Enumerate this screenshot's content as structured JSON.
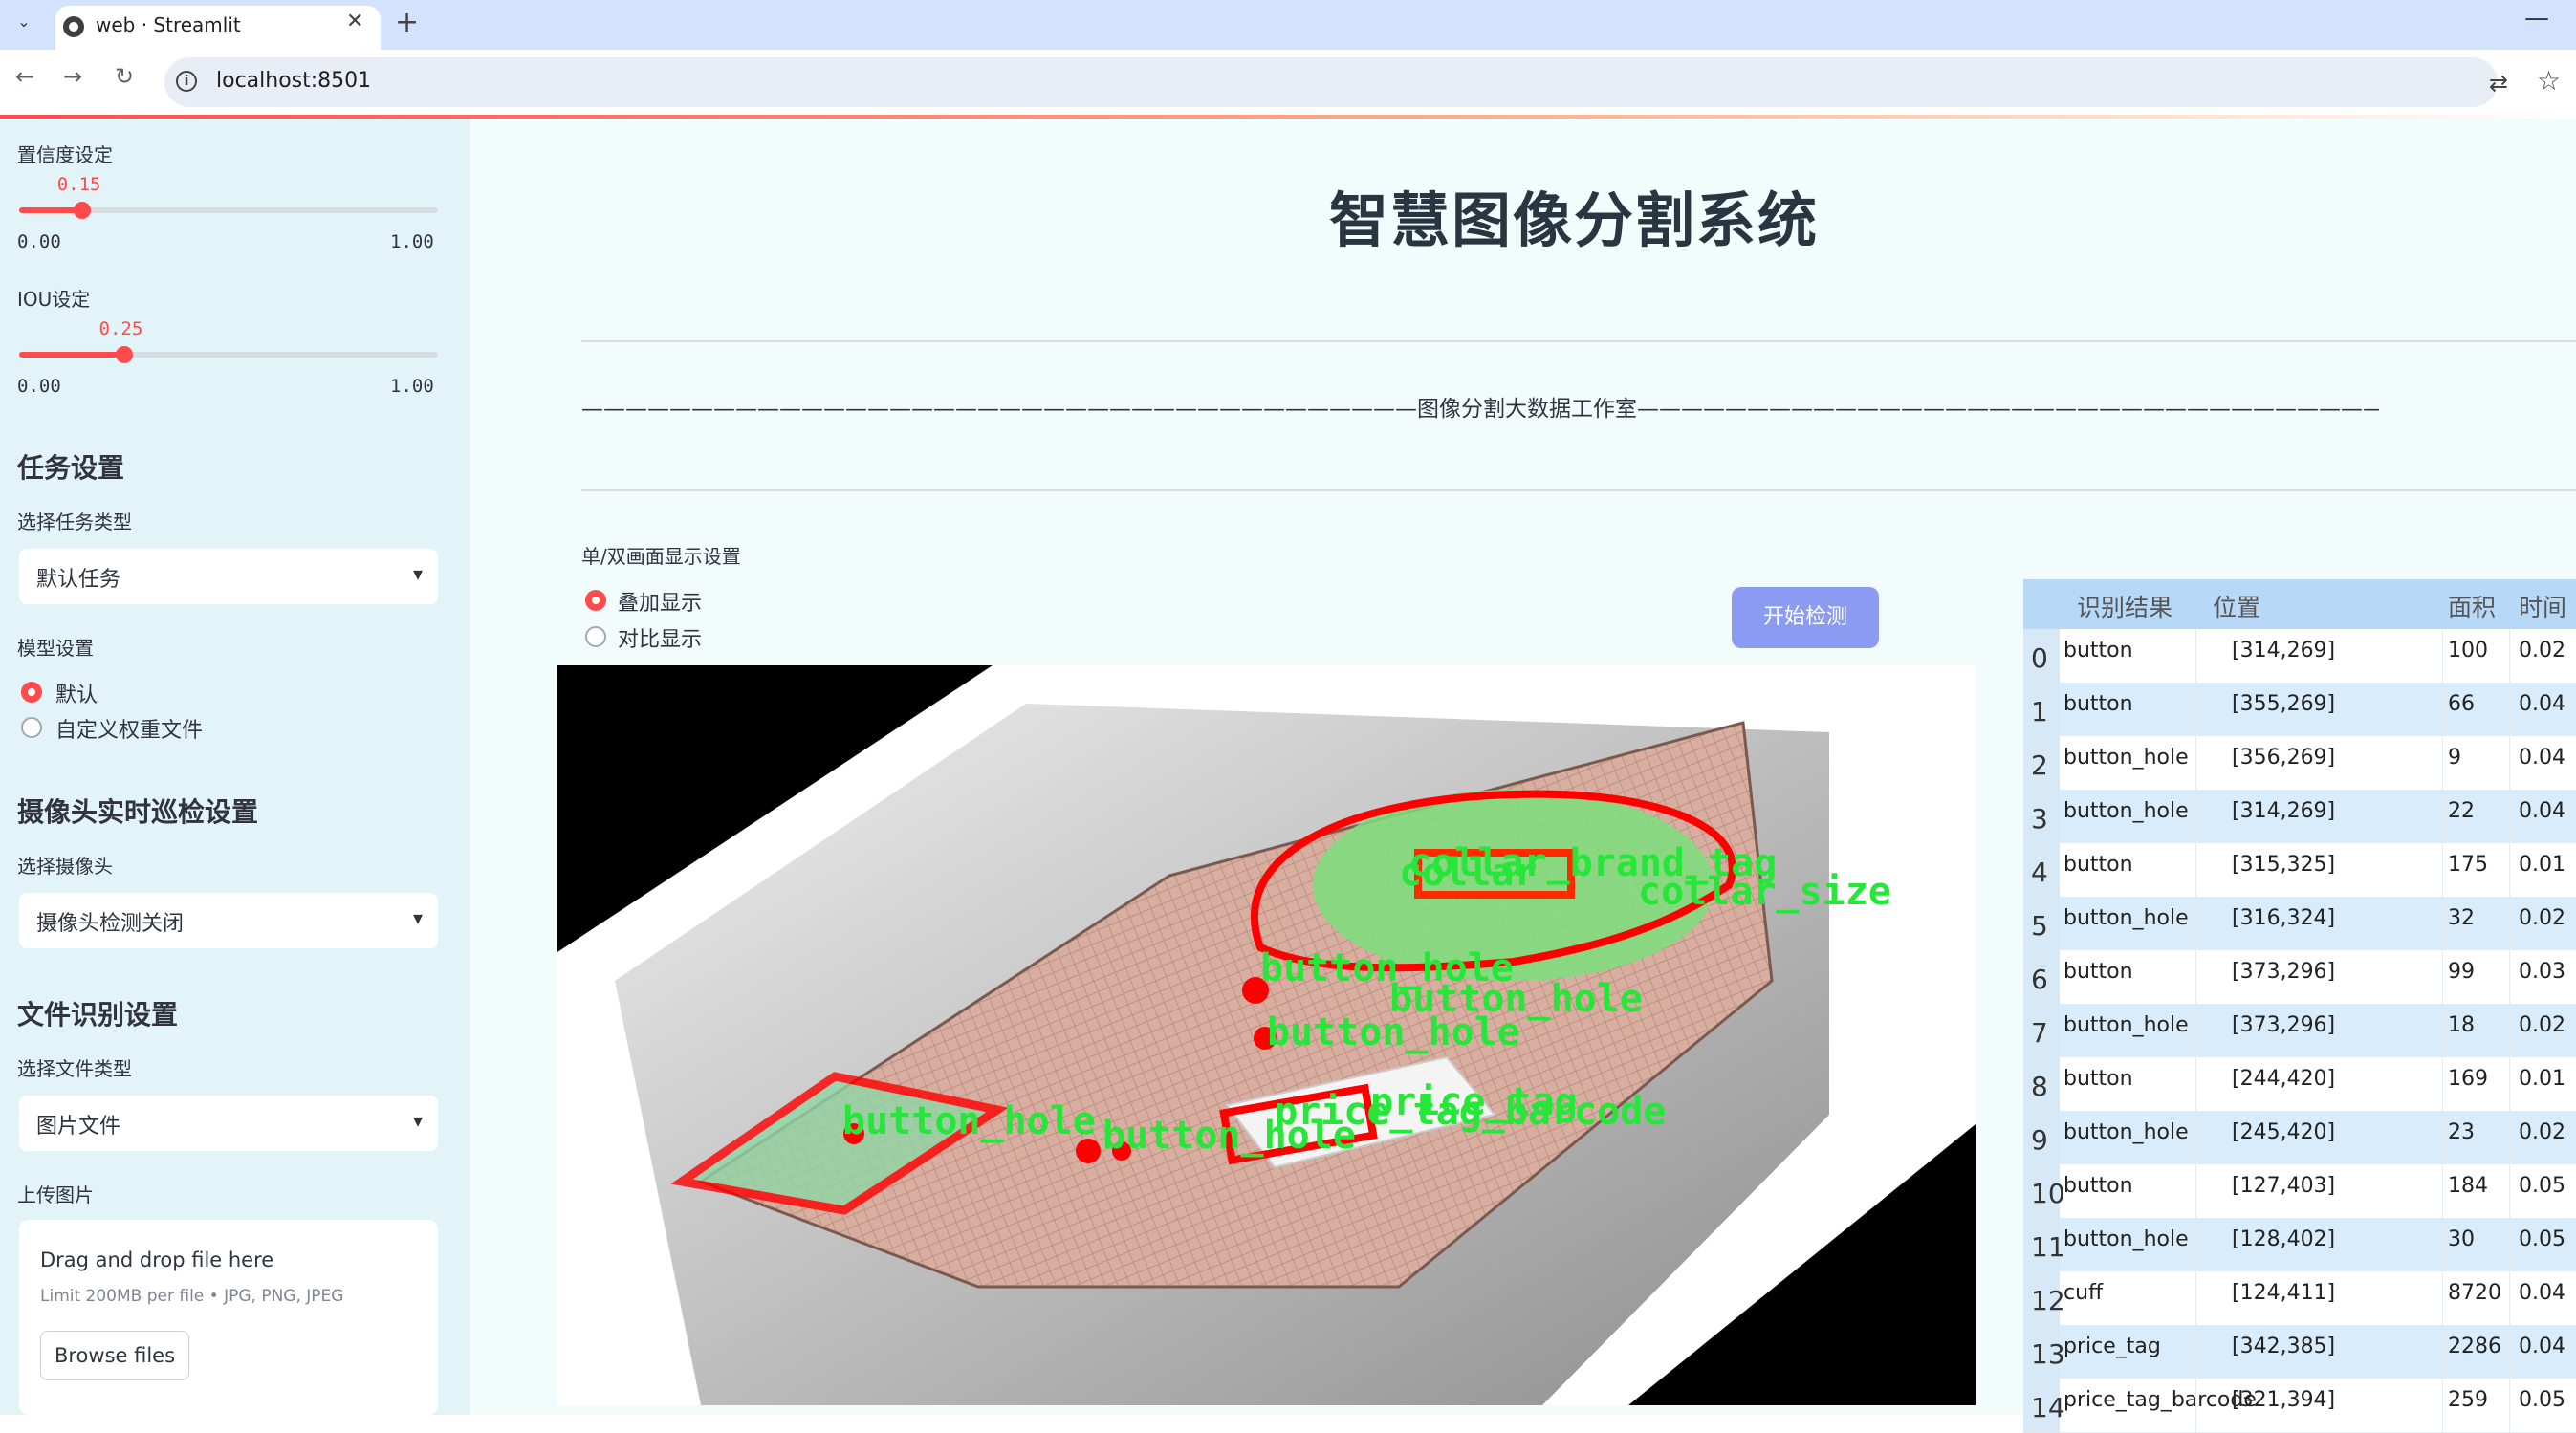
{
  "browser": {
    "tab_title": "web · Streamlit",
    "close_glyph": "✕",
    "newtab_glyph": "+",
    "menu_glyph": "⌄",
    "minimize_glyph": "—",
    "url": "localhost:8501",
    "icons": [
      "back-arrow-icon",
      "forward-arrow-icon",
      "reload-icon",
      "site-info-icon",
      "translate-icon",
      "star-icon"
    ]
  },
  "sidebar": {
    "confidence": {
      "label": "置信度设定",
      "value": "0.15",
      "fraction": 0.15,
      "min": "0.00",
      "max": "1.00"
    },
    "iou": {
      "label": "IOU设定",
      "value": "0.25",
      "fraction": 0.25,
      "min": "0.00",
      "max": "1.00"
    },
    "task_section": "任务设置",
    "task_type_label": "选择任务类型",
    "task_type_value": "默认任务",
    "model_label": "模型设置",
    "model_options": [
      "默认",
      "自定义权重文件"
    ],
    "model_selected": 0,
    "camera_section": "摄像头实时巡检设置",
    "camera_label": "选择摄像头",
    "camera_value": "摄像头检测关闭",
    "file_section": "文件识别设置",
    "file_type_label": "选择文件类型",
    "file_type_value": "图片文件",
    "upload_label": "上传图片",
    "drop_text": "Drag and drop file here",
    "drop_limit": "Limit 200MB per file • JPG, PNG, JPEG",
    "browse_label": "Browse files"
  },
  "main": {
    "title": "智慧图像分割系统",
    "banner": "——————————————————————————————————————图像分割大数据工作室————————————————————————————————————————",
    "display_label": "单/双画面显示设置",
    "display_options": [
      "叠加显示",
      "对比显示"
    ],
    "display_selected": 0,
    "detect_button": "开始检测",
    "overlay_labels": [
      "collar",
      "collar_brand_tag",
      "collar_size",
      "button_hole",
      "button_hole",
      "button_hole",
      "price_tag",
      "price_tag_barcode",
      "button_hole",
      "button_hole"
    ]
  },
  "table": {
    "headers": [
      "识别结果",
      "位置",
      "面积",
      "时间"
    ],
    "rows": [
      {
        "idx": "0",
        "name": "button",
        "pos": "[314,269]",
        "area": "100",
        "time": "0.02"
      },
      {
        "idx": "1",
        "name": "button",
        "pos": "[355,269]",
        "area": "66",
        "time": "0.04"
      },
      {
        "idx": "2",
        "name": "button_hole",
        "pos": "[356,269]",
        "area": "9",
        "time": "0.04"
      },
      {
        "idx": "3",
        "name": "button_hole",
        "pos": "[314,269]",
        "area": "22",
        "time": "0.04"
      },
      {
        "idx": "4",
        "name": "button",
        "pos": "[315,325]",
        "area": "175",
        "time": "0.01"
      },
      {
        "idx": "5",
        "name": "button_hole",
        "pos": "[316,324]",
        "area": "32",
        "time": "0.02"
      },
      {
        "idx": "6",
        "name": "button",
        "pos": "[373,296]",
        "area": "99",
        "time": "0.03"
      },
      {
        "idx": "7",
        "name": "button_hole",
        "pos": "[373,296]",
        "area": "18",
        "time": "0.02"
      },
      {
        "idx": "8",
        "name": "button",
        "pos": "[244,420]",
        "area": "169",
        "time": "0.01"
      },
      {
        "idx": "9",
        "name": "button_hole",
        "pos": "[245,420]",
        "area": "23",
        "time": "0.02"
      },
      {
        "idx": "10",
        "name": "button",
        "pos": "[127,403]",
        "area": "184",
        "time": "0.05"
      },
      {
        "idx": "11",
        "name": "button_hole",
        "pos": "[128,402]",
        "area": "30",
        "time": "0.05"
      },
      {
        "idx": "12",
        "name": "cuff",
        "pos": "[124,411]",
        "area": "8720",
        "time": "0.04"
      },
      {
        "idx": "13",
        "name": "price_tag",
        "pos": "[342,385]",
        "area": "2286",
        "time": "0.04"
      },
      {
        "idx": "14",
        "name": "price_tag_barcode",
        "pos": "[321,394]",
        "area": "259",
        "time": "0.05"
      }
    ]
  },
  "colors": {
    "accent": "#ff4b4b",
    "sidebar_bg": "#e3f4f8",
    "main_bg": "#f2fcfd",
    "button_bg": "#8b9bf2",
    "table_header": "#b7d8f7",
    "mask_green": "#5ed25e",
    "outline_red": "#ff0000"
  }
}
